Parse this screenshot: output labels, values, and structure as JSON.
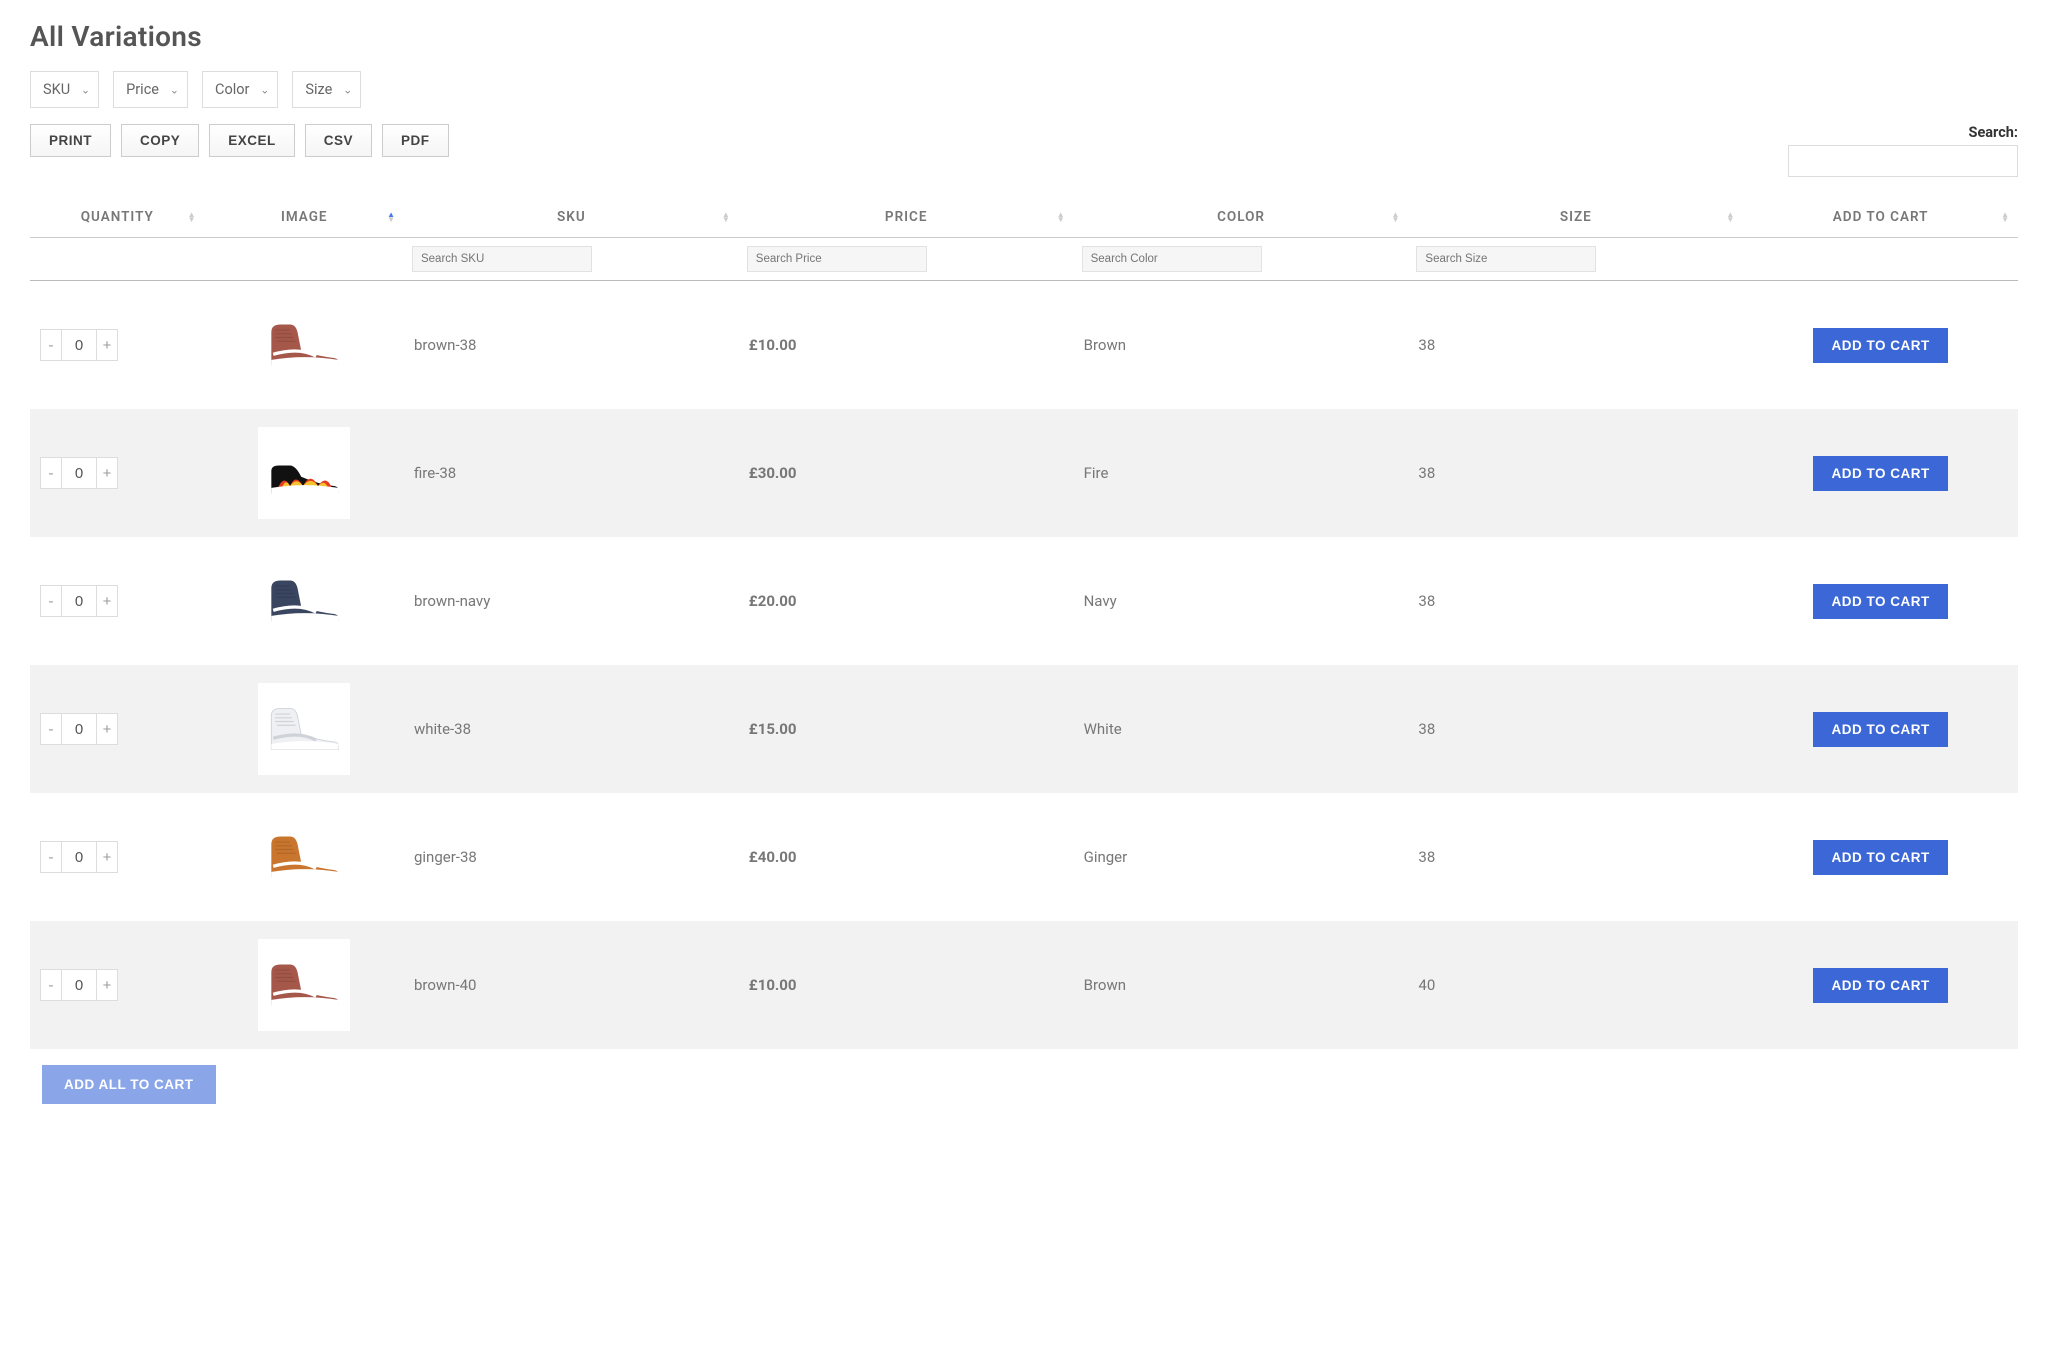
{
  "title": "All Variations",
  "filters": [
    {
      "label": "SKU"
    },
    {
      "label": "Price"
    },
    {
      "label": "Color"
    },
    {
      "label": "Size"
    }
  ],
  "export_buttons": {
    "print": "PRINT",
    "copy": "COPY",
    "excel": "EXCEL",
    "csv": "CSV",
    "pdf": "PDF"
  },
  "search": {
    "label": "Search:"
  },
  "columns": {
    "quantity": "Quantity",
    "image": "Image",
    "sku": "SKU",
    "price": "Price",
    "color": "Color",
    "size": "Size",
    "add_to_cart": "Add To Cart"
  },
  "column_filters": {
    "sku": "Search SKU",
    "price": "Search Price",
    "color": "Search Color",
    "size": "Search Size"
  },
  "add_to_cart_label": "ADD TO CART",
  "add_all_label": "ADD ALL TO CART",
  "rows": [
    {
      "qty": "0",
      "sku": "brown-38",
      "price": "£10.00",
      "color": "Brown",
      "size": "38",
      "shoe": "brown_hi"
    },
    {
      "qty": "0",
      "sku": "fire-38",
      "price": "£30.00",
      "color": "Fire",
      "size": "38",
      "shoe": "fire"
    },
    {
      "qty": "0",
      "sku": "brown-navy",
      "price": "£20.00",
      "color": "Navy",
      "size": "38",
      "shoe": "navy"
    },
    {
      "qty": "0",
      "sku": "white-38",
      "price": "£15.00",
      "color": "White",
      "size": "38",
      "shoe": "white"
    },
    {
      "qty": "0",
      "sku": "ginger-38",
      "price": "£40.00",
      "color": "Ginger",
      "size": "38",
      "shoe": "ginger"
    },
    {
      "qty": "0",
      "sku": "brown-40",
      "price": "£10.00",
      "color": "Brown",
      "size": "40",
      "shoe": "brown_hi"
    }
  ]
}
